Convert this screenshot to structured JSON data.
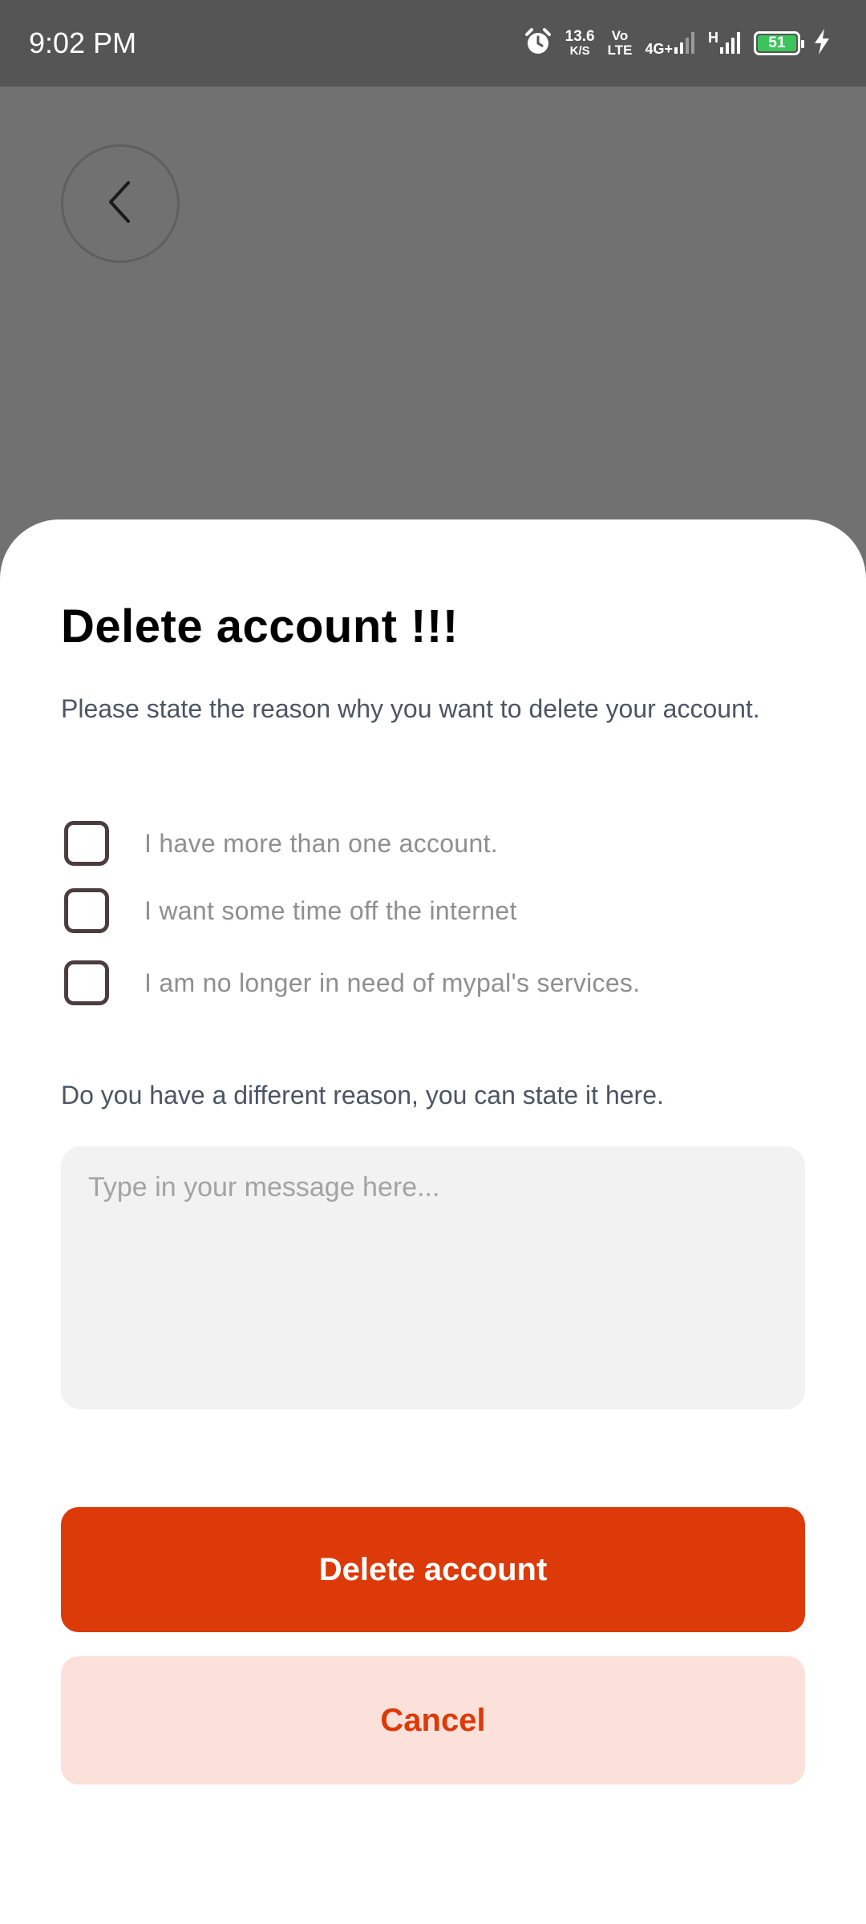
{
  "status_bar": {
    "time": "9:02 PM",
    "net_speed": "13.6",
    "net_speed_unit": "K/S",
    "volte_top": "Vo",
    "volte_bottom": "LTE",
    "network_4g": "4G+",
    "network_h": "H",
    "battery_level": "51",
    "battery_color": "#3cc45c",
    "icons": [
      "alarm-icon",
      "signal-icon",
      "signal-icon",
      "charging-icon"
    ]
  },
  "header": {
    "back_icon": "chevron-left-icon"
  },
  "sheet": {
    "title": "Delete account !!!",
    "subtitle": "Please state the reason why you want to delete your account.",
    "reasons": [
      {
        "label": "I have more than one account.",
        "checked": false
      },
      {
        "label": "I want some time off the internet",
        "checked": false
      },
      {
        "label": "I am no longer in need of mypal's services.",
        "checked": false
      }
    ],
    "other_reason_label": "Do you have a different reason, you can state it here.",
    "message_placeholder": "Type in your message here...",
    "message_value": "",
    "delete_label": "Delete account",
    "cancel_label": "Cancel"
  },
  "colors": {
    "accent": "#dc3a09",
    "accent_light": "#fbe1da",
    "overlay": "#717171"
  }
}
